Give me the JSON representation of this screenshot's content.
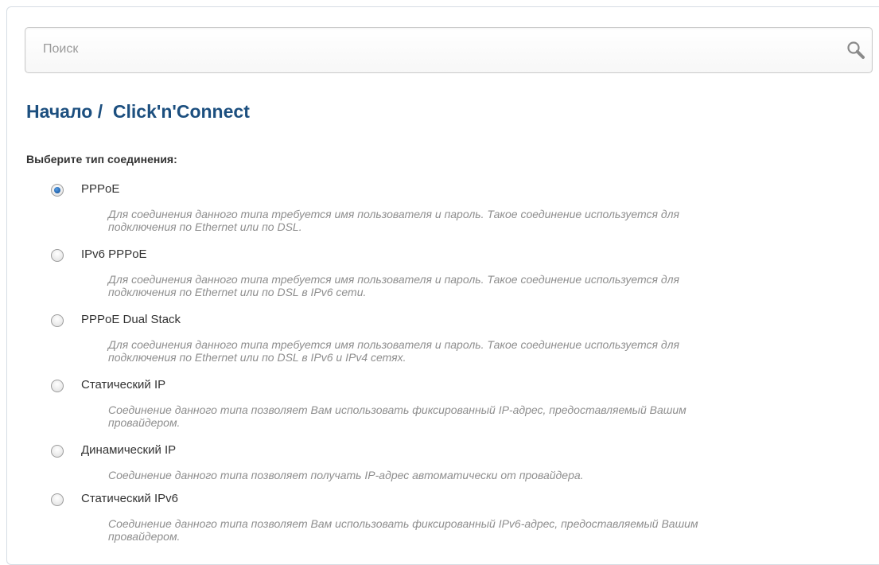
{
  "search": {
    "placeholder": "Поиск",
    "value": ""
  },
  "header": {
    "breadcrumb": "Начало /  Click'n'Connect"
  },
  "section": {
    "label": "Выберите тип соединения:"
  },
  "connection_types": [
    {
      "label": "PPPoE",
      "selected": true,
      "description": "Для соединения данного типа требуется имя пользователя и пароль. Такое соединение используется для подключения по Ethernet или по DSL."
    },
    {
      "label": "IPv6 PPPoE",
      "selected": false,
      "description": "Для соединения данного типа требуется имя пользователя и пароль. Такое соединение используется для подключения по Ethernet или по DSL в IPv6 сети."
    },
    {
      "label": "PPPoE Dual Stack",
      "selected": false,
      "description": "Для соединения данного типа требуется имя пользователя и пароль. Такое соединение используется для подключения по Ethernet или по DSL в IPv6 и IPv4 сетях."
    },
    {
      "label": "Статический IP",
      "selected": false,
      "description": "Соединение данного типа позволяет Вам использовать фиксированный IP-адрес, предоставляемый Вашим провайдером."
    },
    {
      "label": "Динамический IP",
      "selected": false,
      "description": "Соединение данного типа позволяет получать IP-адрес автоматически от провайдера."
    },
    {
      "label": "Статический IPv6",
      "selected": false,
      "description": "Соединение данного типа позволяет Вам использовать фиксированный IPv6-адрес, предоставляемый Вашим провайдером."
    }
  ],
  "colors": {
    "title": "#1c4f7f",
    "label": "#333333",
    "description": "#8e8e8e",
    "radio_selected": "#1e5fa8"
  },
  "icons": {
    "search": "search-icon"
  }
}
